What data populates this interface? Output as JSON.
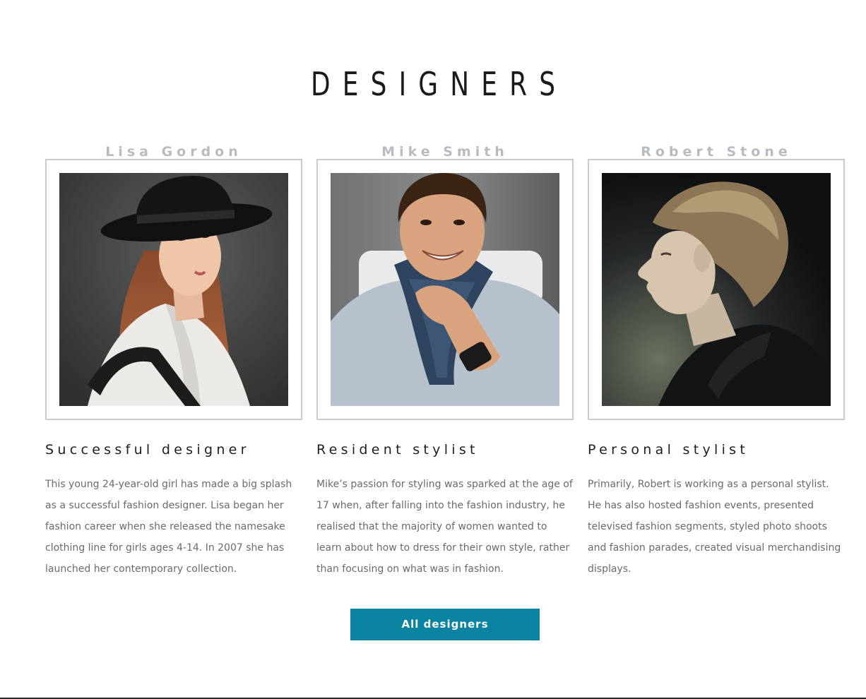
{
  "section": {
    "title": "DESIGNERS"
  },
  "designers": [
    {
      "name": "Lisa Gordon",
      "role": "Successful designer",
      "bio": "This young 24-year-old girl has made a big splash as a successful fashion designer. Lisa began her fashion career when she released the namesake clothing line for girls ages 4-14. In 2007 she has launched her contemporary collection."
    },
    {
      "name": "Mike Smith",
      "role": "Resident stylist",
      "bio": "Mike’s passion for styling was sparked at the age of 17 when, after falling into the fashion industry, he realised that the majority of women wanted to learn about how to dress for their own style, rather than focusing on what was in fashion."
    },
    {
      "name": "Robert Stone",
      "role": "Personal stylist",
      "bio": "Primarily, Robert is working as a personal stylist. He has also hosted fashion events, presented televised fashion segments, styled photo shoots and fashion parades, created visual merchandising displays."
    }
  ],
  "cta": {
    "label": "All designers"
  },
  "colors": {
    "accent": "#0a84a0",
    "name_gray": "#b8bcc2",
    "frame_border": "#c9cbce",
    "body_text": "#6b6b6b"
  }
}
